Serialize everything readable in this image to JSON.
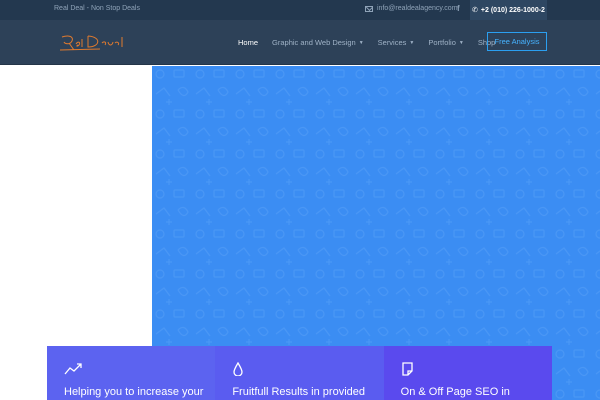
{
  "topbar": {
    "tagline": "Real Deal - Non Stop Deals",
    "email": "info@realdealagency.com",
    "facebook_icon": "facebook-icon",
    "phone": "+2 (010) 226-1000-2"
  },
  "header": {
    "logo_text": "Real Deal",
    "nav": [
      {
        "label": "Home"
      },
      {
        "label": "Graphic and Web Design"
      },
      {
        "label": "Services"
      },
      {
        "label": "Portfolio"
      },
      {
        "label": "Shop"
      }
    ],
    "cta_label": "Free Analysis"
  },
  "features": [
    {
      "icon": "trend-up-icon",
      "text": "Helping you to increase your"
    },
    {
      "icon": "drop-icon",
      "text": "Fruitfull Results in provided"
    },
    {
      "icon": "note-icon",
      "text": "On & Off Page SEO in"
    }
  ],
  "colors": {
    "topbar_bg": "#23384f",
    "header_bg": "#2d4158",
    "accent": "#2b9ff0",
    "hero_bg": "#3b8df3",
    "feature_bg": "#5a5cf0"
  }
}
